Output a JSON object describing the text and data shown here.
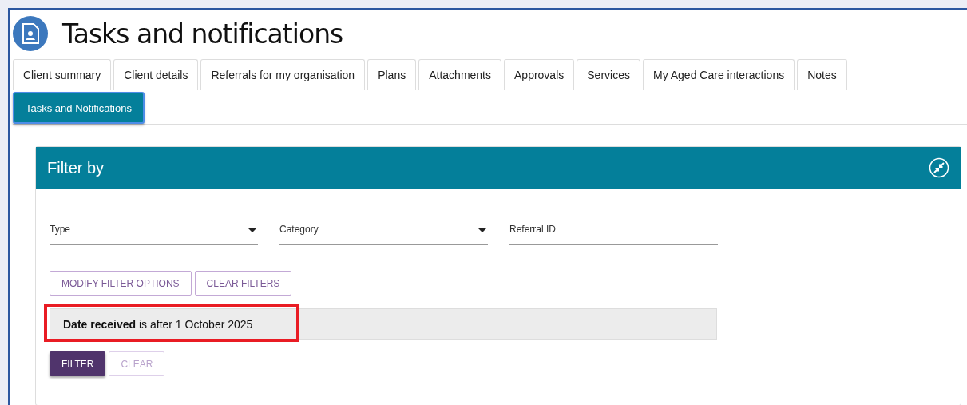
{
  "page": {
    "title": "Tasks and notifications"
  },
  "tabs": [
    {
      "label": "Client summary",
      "selected": false
    },
    {
      "label": "Client details",
      "selected": false
    },
    {
      "label": "Referrals for my organisation",
      "selected": false
    },
    {
      "label": "Plans",
      "selected": false
    },
    {
      "label": "Attachments",
      "selected": false
    },
    {
      "label": "Approvals",
      "selected": false
    },
    {
      "label": "Services",
      "selected": false
    },
    {
      "label": "My Aged Care interactions",
      "selected": false
    },
    {
      "label": "Notes",
      "selected": false
    },
    {
      "label": "Tasks and Notifications",
      "selected": true
    }
  ],
  "filter_panel": {
    "title": "Filter by",
    "fields": [
      {
        "label": "Type",
        "kind": "dropdown"
      },
      {
        "label": "Category",
        "kind": "dropdown"
      },
      {
        "label": "Referral ID",
        "kind": "text"
      }
    ],
    "option_buttons": [
      {
        "label": "MODIFY FILTER OPTIONS",
        "disabled": false
      },
      {
        "label": "CLEAR FILTERS",
        "disabled": false
      }
    ],
    "active_filter": {
      "text": "**Date received** is after 1 October 2025",
      "highlighted": true
    },
    "action_buttons": [
      {
        "label": "FILTER",
        "kind": "primary",
        "disabled": false
      },
      {
        "label": "CLEAR",
        "kind": "secondary",
        "disabled": true
      }
    ]
  }
}
